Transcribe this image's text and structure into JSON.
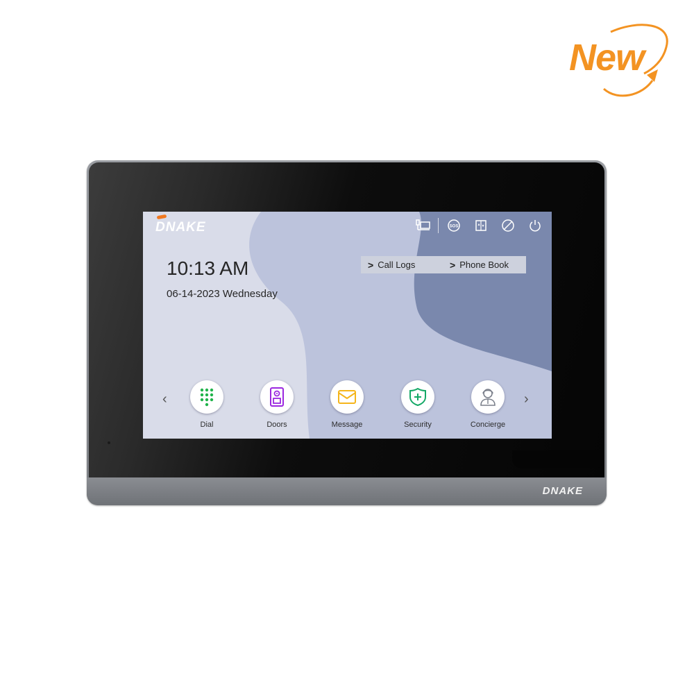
{
  "badge": {
    "text": "New",
    "color": "#f39322"
  },
  "device": {
    "brand": "DNAKE",
    "screen": {
      "logo": "DNAKE",
      "clock": {
        "time": "10:13 AM",
        "date": "06-14-2023 Wednesday"
      },
      "status_icons": [
        {
          "name": "monitor-icon"
        },
        {
          "name": "sos-icon",
          "text": "SOS"
        },
        {
          "name": "elevator-icon"
        },
        {
          "name": "do-not-disturb-icon"
        },
        {
          "name": "power-icon"
        }
      ],
      "quick_links": [
        {
          "label": "Call Logs"
        },
        {
          "label": "Phone Book"
        }
      ],
      "apps": [
        {
          "label": "Dial",
          "icon": "dialpad-icon",
          "color": "#1fb34a"
        },
        {
          "label": "Doors",
          "icon": "door-station-icon",
          "color": "#9b27e0"
        },
        {
          "label": "Message",
          "icon": "envelope-icon",
          "color": "#f5b51b"
        },
        {
          "label": "Security",
          "icon": "shield-plus-icon",
          "color": "#14a866"
        },
        {
          "label": "Concierge",
          "icon": "concierge-agent-icon",
          "color": "#7a7f8a"
        }
      ],
      "nav": {
        "prev": "‹",
        "next": "›"
      }
    }
  }
}
